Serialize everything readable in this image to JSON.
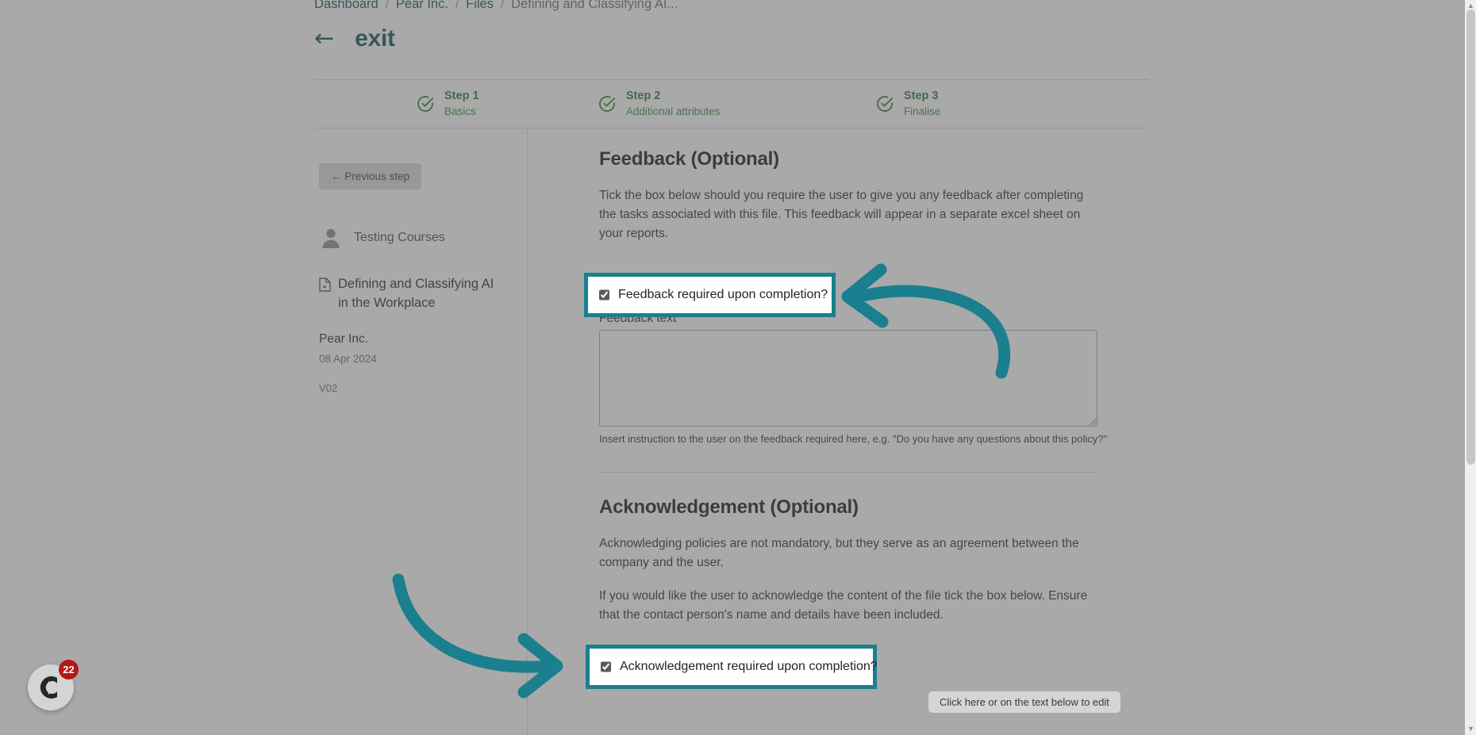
{
  "breadcrumb": {
    "items": [
      {
        "label": "Dashboard"
      },
      {
        "label": "Pear Inc."
      },
      {
        "label": "Files"
      },
      {
        "label": "Defining and Classifying AI..."
      }
    ],
    "separator": "/"
  },
  "header": {
    "back_arrow": "←",
    "exit_label": "exit"
  },
  "steps": [
    {
      "title": "Step 1",
      "subtitle": "Basics",
      "state": "complete"
    },
    {
      "title": "Step 2",
      "subtitle": "Additional attributes",
      "state": "complete"
    },
    {
      "title": "Step 3",
      "subtitle": "Finalise",
      "state": "complete"
    }
  ],
  "sidebar": {
    "previous_step_label": "← Previous step",
    "owner_name": "Testing Courses",
    "file_title": "Defining and Classifying AI in the Workplace",
    "company": "Pear Inc.",
    "date": "08 Apr 2024",
    "version": "V02"
  },
  "feedback": {
    "title": "Feedback (Optional)",
    "description": "Tick the box below should you require the user to give you any feedback after completing the tasks associated with this file. This feedback will appear in a separate excel sheet on your reports.",
    "checkbox_label": "Feedback required upon completion?",
    "checkbox_checked": true,
    "textarea_label": "Feedback text",
    "textarea_value": "",
    "textarea_placeholder": "",
    "helper_text": "Insert instruction to the user on the feedback required here, e.g. \"Do you have any questions about this policy?\""
  },
  "acknowledgement": {
    "title": "Acknowledgement (Optional)",
    "paragraph_1": "Acknowledging policies are not mandatory, but they serve as an agreement between the company and the user.",
    "paragraph_2": "If you would like the user to acknowledge the content of the file tick the box below. Ensure that the contact person's name and details have been included.",
    "checkbox_label": "Acknowledgement required upon completion?",
    "checkbox_checked": true
  },
  "edit_hint": {
    "label": "Click here or on the text below to edit"
  },
  "chat_widget": {
    "badge_count": "22"
  },
  "colors": {
    "accent_teal": "#1a7f8e",
    "brand_dark_teal": "#15525d",
    "step_green": "#2e7a31",
    "badge_red": "#b31818"
  }
}
